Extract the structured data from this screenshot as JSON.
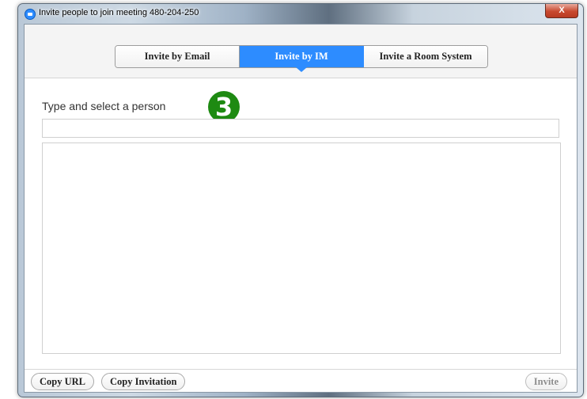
{
  "window": {
    "title": "Invite people to join meeting 480-204-250",
    "close_label": "X"
  },
  "tabs": [
    {
      "label": "Invite by Email",
      "active": false
    },
    {
      "label": "Invite by IM",
      "active": true
    },
    {
      "label": "Invite a Room System",
      "active": false
    }
  ],
  "form": {
    "prompt": "Type and select a person",
    "input_value": "",
    "input_placeholder": ""
  },
  "annotation": {
    "step_number": "3",
    "color": "#1e8a12"
  },
  "footer": {
    "copy_url_label": "Copy URL",
    "copy_invitation_label": "Copy Invitation",
    "invite_label": "Invite",
    "invite_enabled": false
  },
  "colors": {
    "accent": "#2d8cff"
  },
  "icons": {
    "app": "zoom-app-icon",
    "close": "close-icon"
  }
}
